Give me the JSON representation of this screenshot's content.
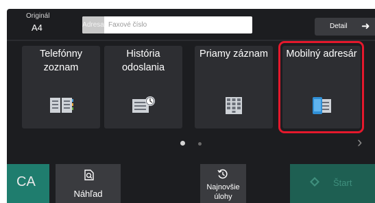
{
  "header": {
    "original_label": "Originál",
    "original_value": "A4",
    "address_tag": "Adresa",
    "address_placeholder": "Faxové číslo",
    "detail_label": "Detail"
  },
  "tiles": [
    {
      "line1": "Telefónny",
      "line2": "zoznam",
      "icon": "address-book-icon"
    },
    {
      "line1": "História",
      "line2": "odoslania",
      "icon": "send-history-icon"
    },
    {
      "line1": "Priamy záznam",
      "line2": "",
      "icon": "keypad-icon"
    },
    {
      "line1": "Mobilný adresár",
      "line2": "",
      "icon": "mobile-address-book-icon"
    }
  ],
  "pager": {
    "pages": 2,
    "current": 1
  },
  "bottom": {
    "ca_label": "CA",
    "preview_label": "Náhľad",
    "recent_line1": "Najnovšie",
    "recent_line2": "úlohy",
    "start_label": "Štart"
  },
  "colors": {
    "highlight": "#e5182c",
    "ca": "#1f7d6e",
    "start": "#1e5f52",
    "background": "#1c1d20"
  }
}
